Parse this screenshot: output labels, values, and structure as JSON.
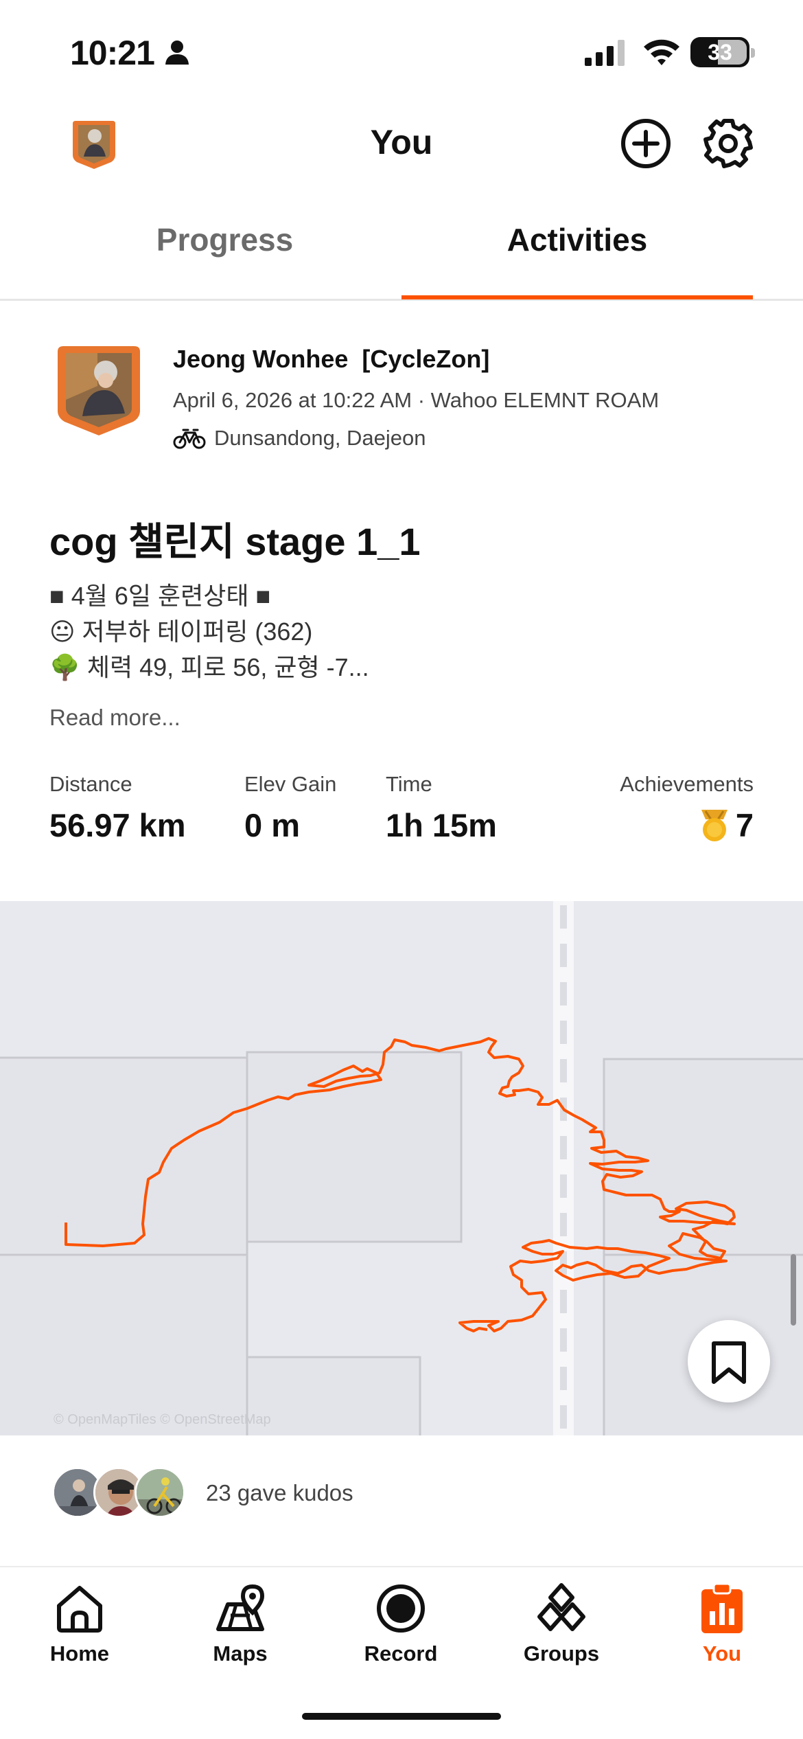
{
  "status_bar": {
    "time": "10:21",
    "battery": "33"
  },
  "header": {
    "title": "You"
  },
  "tabs": [
    {
      "label": "Progress",
      "active": false
    },
    {
      "label": "Activities",
      "active": true
    }
  ],
  "activity": {
    "athlete": "Jeong Wonhee  [CycleZon]",
    "datetime_device": "April 6, 2026 at 10:22 AM · Wahoo ELEMNT ROAM",
    "location": "Dunsandong, Daejeon",
    "title": "cog 챌린지 stage 1_1",
    "description": [
      "■ 4월 6일 훈련상태 ■",
      "😐 저부하 테이퍼링 (362)",
      "🌳 체력 49, 피로 56, 균형 -7..."
    ],
    "read_more": "Read more...",
    "stats": {
      "distance_label": "Distance",
      "distance_value": "56.97 km",
      "elev_label": "Elev Gain",
      "elev_value": "0 m",
      "time_label": "Time",
      "time_value": "1h 15m",
      "achievements_label": "Achievements",
      "achievements_value": "7"
    }
  },
  "map": {
    "attribution": "© OpenMapTiles © OpenStreetMap",
    "route_color": "#fc5200"
  },
  "kudos": {
    "text": "23 gave kudos"
  },
  "bottom_nav": [
    {
      "label": "Home",
      "icon": "home-icon",
      "active": false
    },
    {
      "label": "Maps",
      "icon": "maps-icon",
      "active": false
    },
    {
      "label": "Record",
      "icon": "record-icon",
      "active": false
    },
    {
      "label": "Groups",
      "icon": "groups-icon",
      "active": false
    },
    {
      "label": "You",
      "icon": "you-icon",
      "active": true
    }
  ],
  "colors": {
    "accent": "#fc5200",
    "text": "#111111",
    "muted": "#444444"
  }
}
